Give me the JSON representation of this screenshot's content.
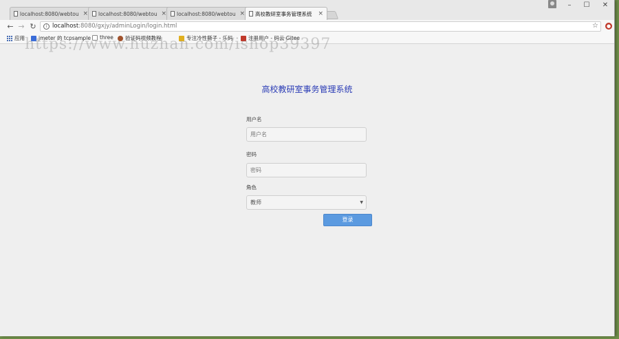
{
  "browser": {
    "tabs": [
      {
        "label": "localhost:8080/webtou",
        "active": false
      },
      {
        "label": "localhost:8080/webtou",
        "active": false
      },
      {
        "label": "localhost:8080/webtou",
        "active": false
      },
      {
        "label": "高校教研室事务管理系统",
        "active": true
      }
    ],
    "url_host": "localhost",
    "url_rest": ":8080/gxjy/adminLogin/login.html",
    "bookmarks": [
      {
        "label": "应用",
        "icon": "apps-grid-icon",
        "color": "#4a6fb5"
      },
      {
        "label": "jmeter 的 tcpsample",
        "icon": "shield-icon",
        "color": "#3b6dd8"
      },
      {
        "label": "three",
        "icon": "page-icon",
        "color": "#888888"
      },
      {
        "label": "验证码视频教程",
        "icon": "avatar-icon",
        "color": "#a0522d"
      },
      {
        "label": "专注冷性撕子 - 乐码",
        "icon": "hand-icon",
        "color": "#e0b020"
      },
      {
        "label": "注册用户 - 码云 Gitee",
        "icon": "gitee-icon",
        "color": "#c0392b"
      }
    ],
    "watermark": "https://www.huzhan.com/ishop39397"
  },
  "page": {
    "title": "高校教研室事务管理系统",
    "username_label": "用户名",
    "username_placeholder": "用户名",
    "password_label": "密码",
    "password_placeholder": "密码",
    "role_label": "角色",
    "role_selected": "教师",
    "login_button": "登录"
  },
  "colors": {
    "title": "#2a3bb5",
    "button": "#5b9ae0"
  }
}
